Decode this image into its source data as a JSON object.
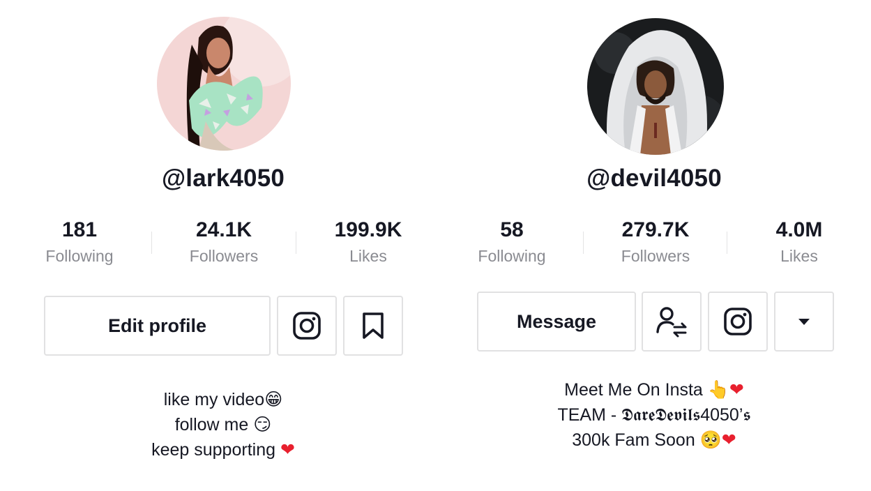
{
  "left_profile": {
    "username": "@lark4050",
    "stats": [
      {
        "value": "181",
        "label": "Following"
      },
      {
        "value": "24.1K",
        "label": "Followers"
      },
      {
        "value": "199.9K",
        "label": "Likes"
      }
    ],
    "buttons": {
      "edit_profile_label": "Edit profile",
      "instagram_icon": "instagram-icon",
      "bookmark_icon": "bookmark-icon"
    },
    "bio": {
      "line1": "like my video",
      "line1_emoji": "😁",
      "line2": "follow me ",
      "line2_emoji": "😏",
      "line3": "keep supporting ",
      "line3_emoji": "❤"
    }
  },
  "right_profile": {
    "username": "@devil4050",
    "stats": [
      {
        "value": "58",
        "label": "Following"
      },
      {
        "value": "279.7K",
        "label": "Followers"
      },
      {
        "value": "4.0M",
        "label": "Likes"
      }
    ],
    "buttons": {
      "message_label": "Message",
      "follow_back_icon": "user-swap-icon",
      "instagram_icon": "instagram-icon",
      "dropdown_icon": "caret-down-icon"
    },
    "bio": {
      "line1": "Meet Me On Insta ",
      "line1_emoji": "👆❤",
      "line2": "TEAM - 𝕯𝖆𝖗𝖊𝕯𝖊𝖛𝖎𝖑𝖘4050’𝖘",
      "line3": "300k Fam Soon ",
      "line3_emoji": "🥺❤"
    }
  },
  "colors": {
    "text": "#161823",
    "secondary_text": "#8a8b91",
    "border": "#e1e1e2",
    "heart": "#e8202e"
  }
}
